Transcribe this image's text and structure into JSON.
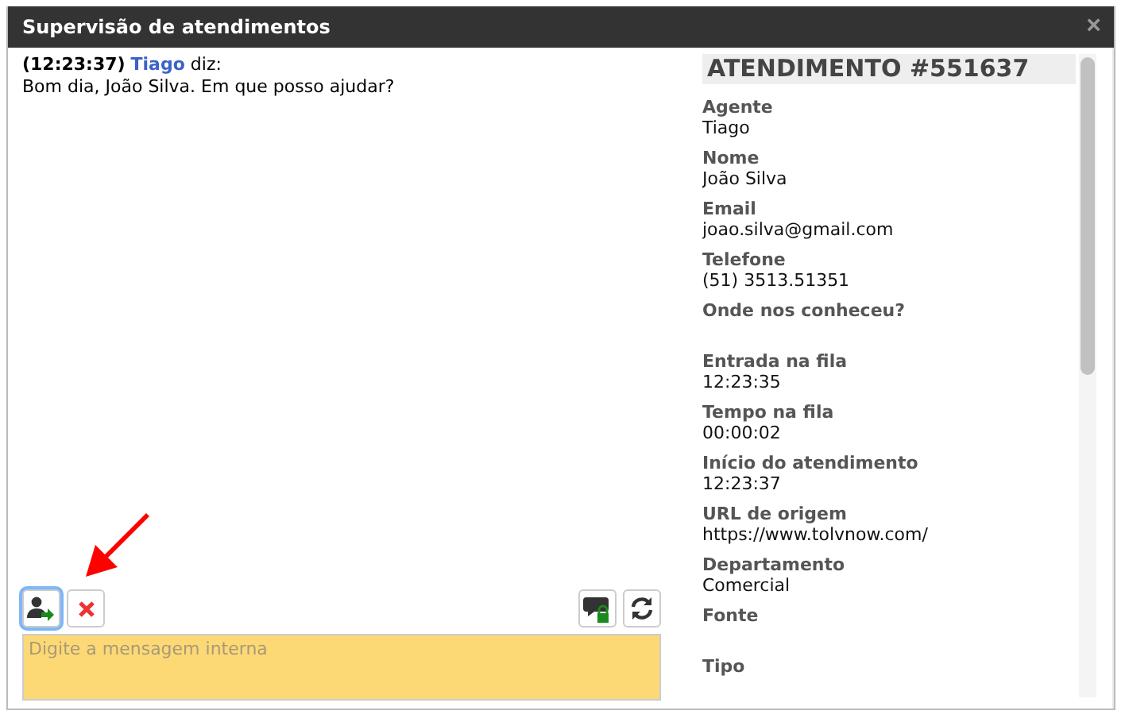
{
  "window": {
    "title": "Supervisão de atendimentos",
    "close": "×"
  },
  "chat": {
    "messages": [
      {
        "time": "(12:23:37)",
        "author": "Tiago",
        "verb": "diz:",
        "text": "Bom dia, João Silva. Em que posso ajudar?"
      }
    ]
  },
  "toolbar": {
    "left": [
      {
        "kind": "transfer",
        "focused": true
      },
      {
        "kind": "close",
        "focused": false
      }
    ],
    "right": [
      {
        "kind": "private-chat",
        "focused": false
      },
      {
        "kind": "refresh",
        "focused": false
      }
    ]
  },
  "message_field": {
    "placeholder": "Digite a mensagem interna"
  },
  "details": {
    "title": "ATENDIMENTO #551637",
    "fields": [
      {
        "label": "Agente",
        "value": "Tiago"
      },
      {
        "label": "Nome",
        "value": "João Silva"
      },
      {
        "label": "Email",
        "value": "joao.silva@gmail.com"
      },
      {
        "label": "Telefone",
        "value": "(51) 3513.51351"
      },
      {
        "label": "Onde nos conheceu?"
      },
      {
        "label": "Entrada na fila",
        "value": "12:23:35"
      },
      {
        "label": "Tempo na fila",
        "value": "00:00:02"
      },
      {
        "label": "Início do atendimento",
        "value": "12:23:37"
      },
      {
        "label": "URL de origem",
        "value": "https://www.tolvnow.com/"
      },
      {
        "label": "Departamento",
        "value": "Comercial"
      },
      {
        "label": "Fonte"
      },
      {
        "label": "Tipo"
      }
    ]
  }
}
